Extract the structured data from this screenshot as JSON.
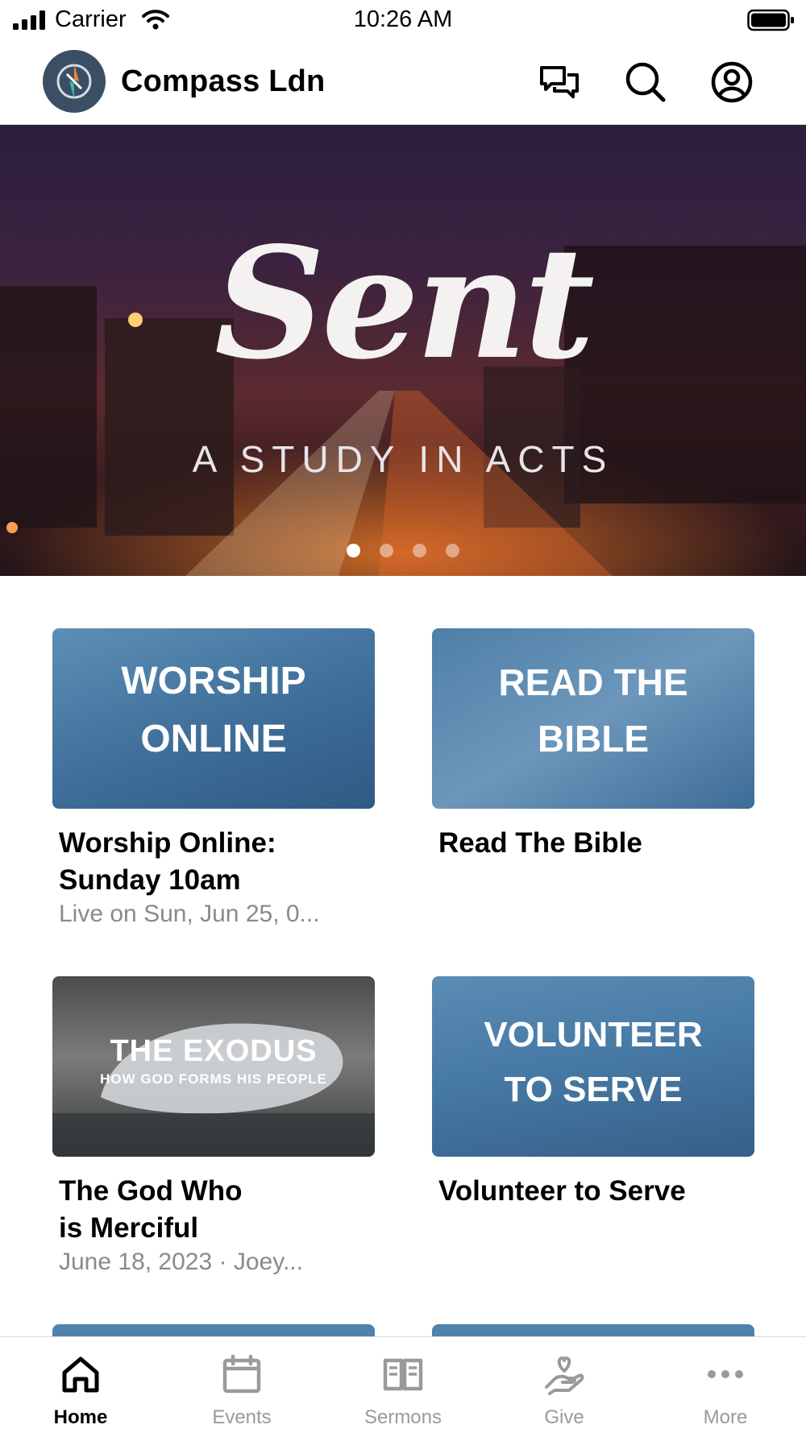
{
  "status_bar": {
    "carrier": "Carrier",
    "time": "10:26 AM"
  },
  "header": {
    "title": "Compass Ldn",
    "icons": [
      "chat-icon",
      "search-icon",
      "profile-icon"
    ]
  },
  "hero": {
    "title": "Sent",
    "subtitle": "A STUDY IN ACTS",
    "page_count": 4,
    "active_page": 1
  },
  "cards": [
    {
      "thumb_line1": "WORSHIP",
      "thumb_line2": "ONLINE",
      "title_line1": "Worship Online:",
      "title_line2": "Sunday 10am",
      "subtitle": "Live on Sun, Jun 25, 0..."
    },
    {
      "thumb_line1": "READ THE",
      "thumb_line2": "BIBLE",
      "title_line1": "Read The Bible"
    },
    {
      "thumb_line1": "THE EXODUS",
      "thumb_line2": "HOW GOD FORMS HIS PEOPLE",
      "title_line1": "The God Who",
      "title_line2": "is Merciful",
      "subtitle": "June 18, 2023 · Joey..."
    },
    {
      "thumb_line1": "VOLUNTEER",
      "thumb_line2": "TO SERVE",
      "title_line1": "Volunteer to Serve"
    }
  ],
  "tabs": [
    {
      "label": "Home",
      "icon": "home-icon",
      "active": true
    },
    {
      "label": "Events",
      "icon": "calendar-icon",
      "active": false
    },
    {
      "label": "Sermons",
      "icon": "book-icon",
      "active": false
    },
    {
      "label": "Give",
      "icon": "give-icon",
      "active": false
    },
    {
      "label": "More",
      "icon": "more-icon",
      "active": false
    }
  ],
  "colors": {
    "accent": "#3e6e99",
    "active_tab": "#000000",
    "inactive_tab": "#9a9a9a"
  }
}
